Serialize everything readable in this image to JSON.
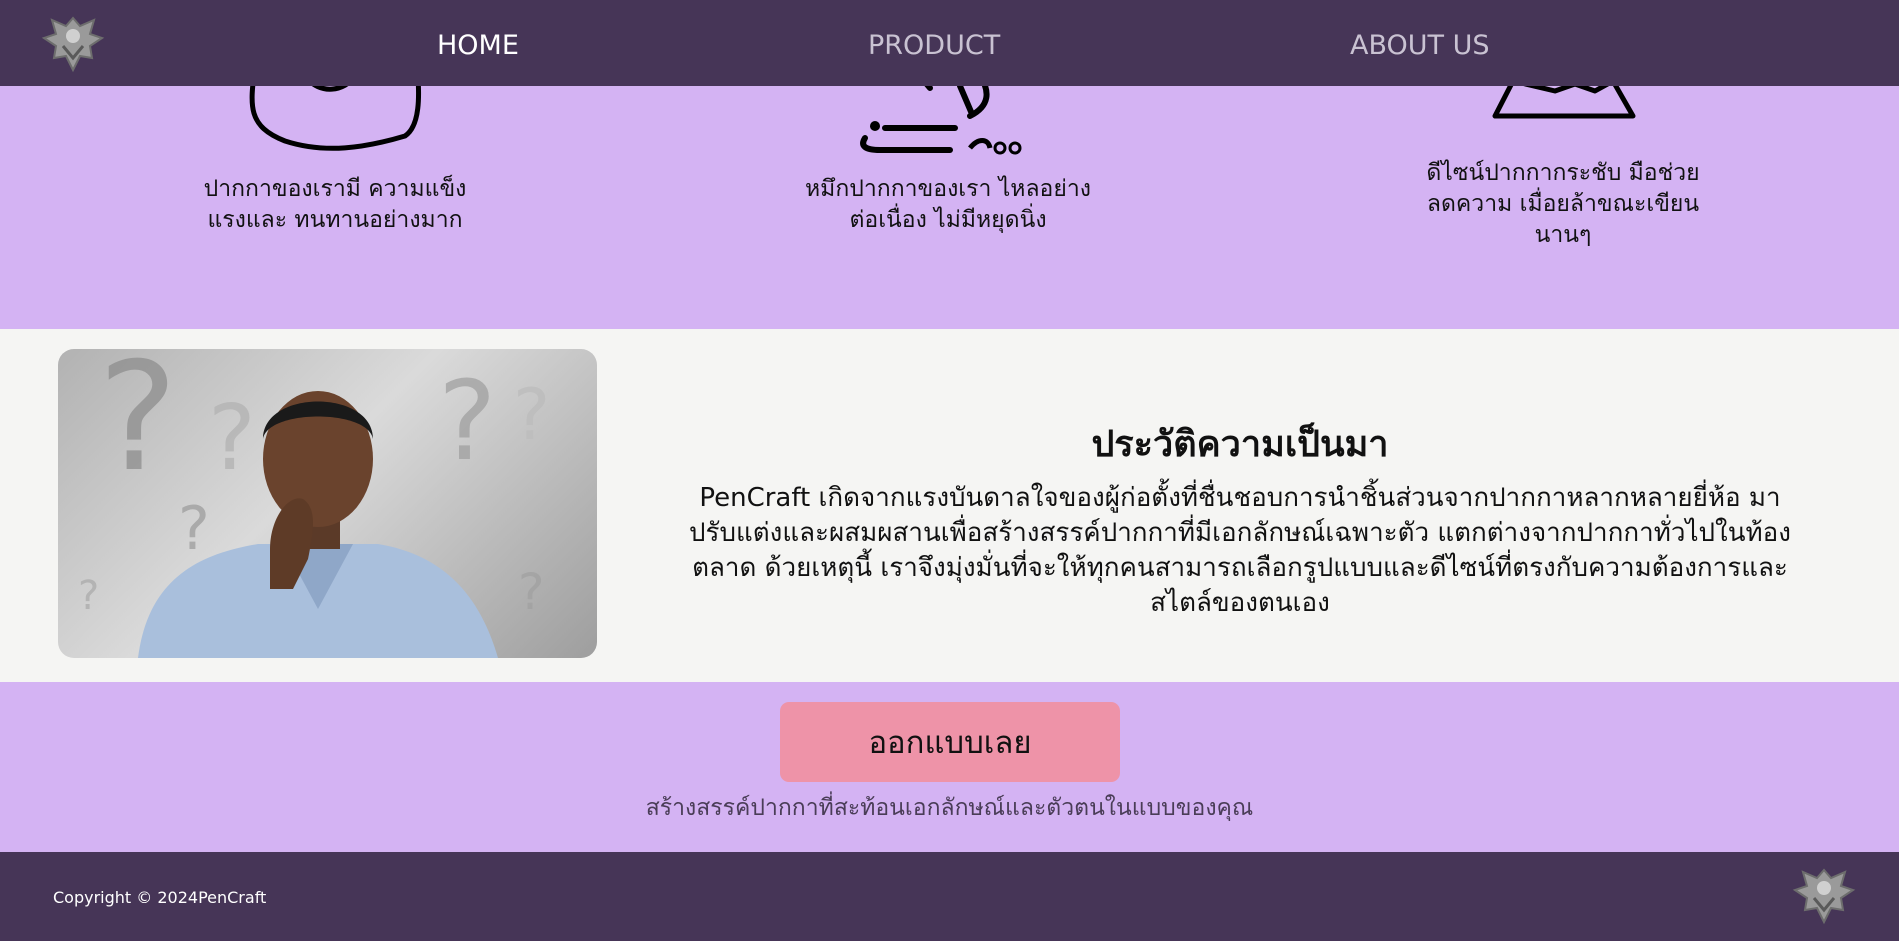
{
  "nav": {
    "links": [
      {
        "label": "HOME"
      },
      {
        "label": "PRODUCT"
      },
      {
        "label": "ABOUT US"
      }
    ]
  },
  "features": [
    {
      "icon": "durable-pen-icon",
      "text": "ปากกาของเรามี ความแข็งแรงและ ทนทานอย่างมาก"
    },
    {
      "icon": "ink-flow-icon",
      "text": "หมึกปากกาของเรา ไหลอย่างต่อเนื่อง ไม่มีหยุดนิ่ง"
    },
    {
      "icon": "ergonomic-grip-icon",
      "text": "ดีไซน์ปากกากระชับ มือช่วยลดความ เมื่อยล้าขณะเขียน นานๆ"
    }
  ],
  "history": {
    "title": "ประวัติความเป็นมา",
    "body": "PenCraft เกิดจากแรงบันดาลใจของผู้ก่อตั้งที่ชื่นชอบการนำชิ้นส่วนจากปากกาหลากหลายยี่ห้อ มาปรับแต่งและผสมผสานเพื่อสร้างสรรค์ปากกาที่มีเอกลักษณ์เฉพาะตัว แตกต่างจากปากกาทั่วไปในท้องตลาด ด้วยเหตุนี้ เราจึงมุ่งมั่นที่จะให้ทุกคนสามารถเลือกรูปแบบและดีไซน์ที่ตรงกับความต้องการและสไตล์ของตนเอง"
  },
  "cta": {
    "button_label": "ออกแบบเลย",
    "subtitle": "สร้างสรรค์ปากกาที่สะท้อนเอกลักษณ์และตัวตนในแบบของคุณ"
  },
  "footer": {
    "copyright": "Copyright © 2024PenCraft"
  },
  "colors": {
    "nav_bg": "#463557",
    "section_bg": "#d4b3f3",
    "cta_button": "#ee93a8",
    "page_bg": "#f5f5f3"
  }
}
